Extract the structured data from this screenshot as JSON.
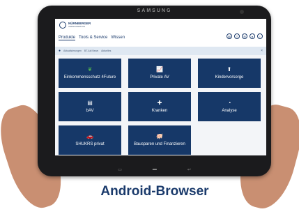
{
  "device": {
    "brand": "SAMSUNG"
  },
  "app": {
    "logo_name": "NÜRNBERGER",
    "logo_sub": "VERSICHERUNG",
    "nav": [
      "Produkte",
      "Tools & Service",
      "Wissen"
    ],
    "header_icons": [
      "doc-icon",
      "share-icon",
      "mail-icon",
      "user-icon",
      "info-icon"
    ]
  },
  "notification": {
    "items": [
      "Aktualisierungen",
      "BT-Aid News",
      "Aktuelles"
    ]
  },
  "tiles": [
    {
      "label": "Einkommensschutz 4Future",
      "icon": "leaf-icon"
    },
    {
      "label": "Private AV",
      "icon": "chart-icon"
    },
    {
      "label": "Kindervorsorge",
      "icon": "child-icon"
    },
    {
      "label": "bAV",
      "icon": "document-icon"
    },
    {
      "label": "Kranken",
      "icon": "medical-icon"
    },
    {
      "label": "Analyse",
      "icon": "pie-icon"
    },
    {
      "label": "SHUKRS privat",
      "icon": "car-icon"
    },
    {
      "label": "Bausparen und Finanzieren",
      "icon": "piggy-icon"
    }
  ],
  "caption": "Android-Browser",
  "colors": {
    "brand_blue": "#163868",
    "leaf_green": "#4caf50"
  }
}
